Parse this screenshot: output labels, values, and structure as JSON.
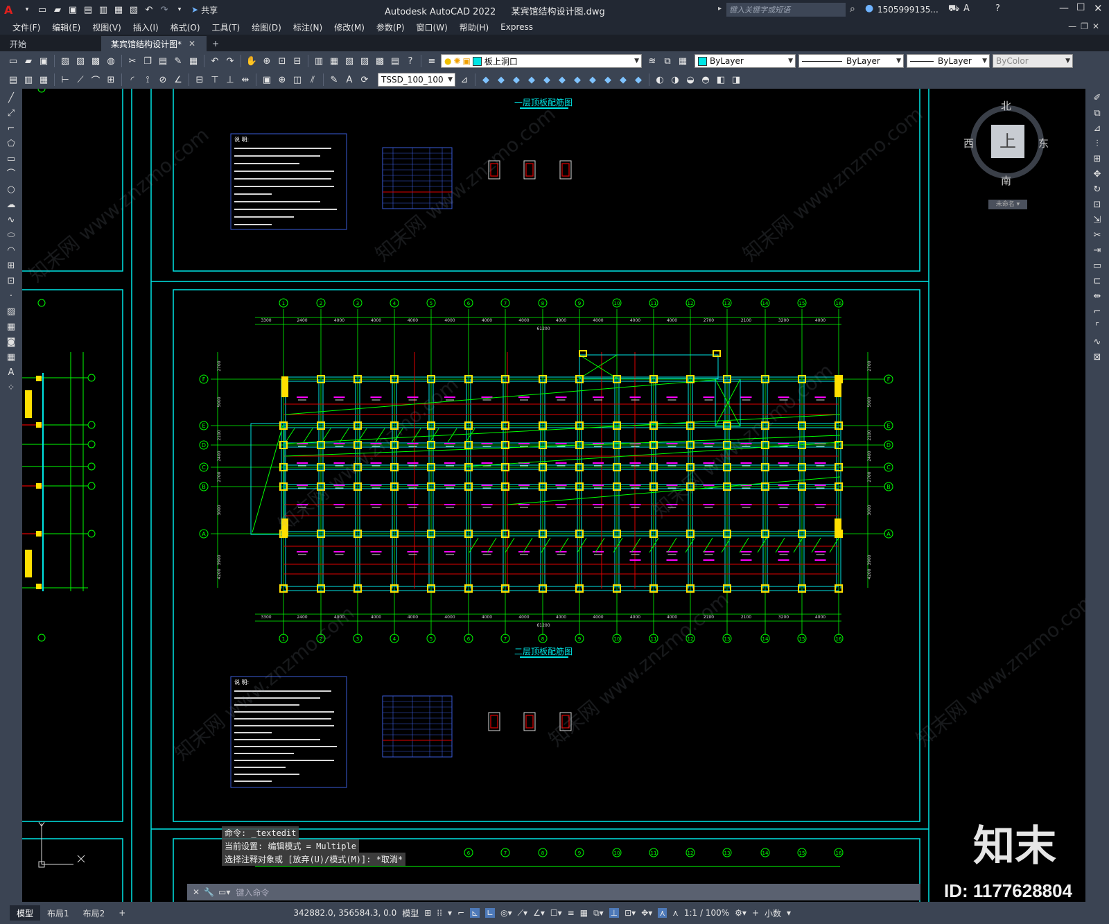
{
  "app": {
    "title": "Autodesk AutoCAD 2022",
    "filename": "某宾馆结构设计图.dwg",
    "share_label": "共享",
    "search_placeholder": "键入关键字或短语",
    "user": "1505999135...",
    "logo_letter": "A"
  },
  "menu": [
    "文件(F)",
    "编辑(E)",
    "视图(V)",
    "插入(I)",
    "格式(O)",
    "工具(T)",
    "绘图(D)",
    "标注(N)",
    "修改(M)",
    "参数(P)",
    "窗口(W)",
    "帮助(H)",
    "Express"
  ],
  "tabs": [
    {
      "label": "开始"
    },
    {
      "label": "某宾馆结构设计图*"
    }
  ],
  "toolbar": {
    "layer_value": "板上洞口",
    "color_value": "ByLayer",
    "linetype_value": "ByLayer",
    "lineweight_value": "ByLayer",
    "plotstyle_value": "ByColor",
    "dimstyle_value": "TSSD_100_100"
  },
  "viewcube": {
    "north": "北",
    "south": "南",
    "east": "东",
    "west": "西",
    "face": "上",
    "ucs": "未命名"
  },
  "drawing": {
    "title_top": "一层顶板配筋图",
    "title_main": "二层顶板配筋图",
    "notes_header": "说 明:",
    "axis_numbers": [
      "1",
      "2",
      "3",
      "4",
      "5",
      "6",
      "7",
      "8",
      "9",
      "10",
      "11",
      "12",
      "13",
      "14",
      "15",
      "16"
    ],
    "axis_letters": [
      "F",
      "E",
      "D",
      "C",
      "B",
      "A"
    ],
    "dims_top": [
      "3300",
      "2400",
      "4000",
      "4000",
      "4000",
      "4000",
      "4000",
      "4000",
      "4000",
      "4000",
      "4000",
      "4000",
      "2700",
      "2100",
      "3200",
      "4000",
      "4000"
    ],
    "total_dim": "61200",
    "side_dims": [
      "2700",
      "5000",
      "2100",
      "2400",
      "2700",
      "3000",
      "3900",
      "4200"
    ],
    "side_total": "25500"
  },
  "command": {
    "line1": "命令: _textedit",
    "line2": "当前设置: 编辑模式 = Multiple",
    "line3": "选择注释对象或 [放弃(U)/模式(M)]: *取消*",
    "placeholder": "键入命令"
  },
  "status": {
    "layout_tabs": [
      "模型",
      "布局1",
      "布局2"
    ],
    "coords": "342882.0, 356584.3, 0.0",
    "space": "模型",
    "scale": "1:1 / 100%",
    "units": "小数"
  },
  "watermark": {
    "brand": "知末",
    "id": "ID: 1177628804",
    "tile": "知末网 www.znzmo.com"
  },
  "colors": {
    "cyan": "#00e5e5",
    "green": "#00ff00",
    "yellow": "#ffe000",
    "magenta": "#ff00ff",
    "red": "#e00000",
    "ui_dark": "#222833",
    "ui_mid": "#3b4453"
  }
}
